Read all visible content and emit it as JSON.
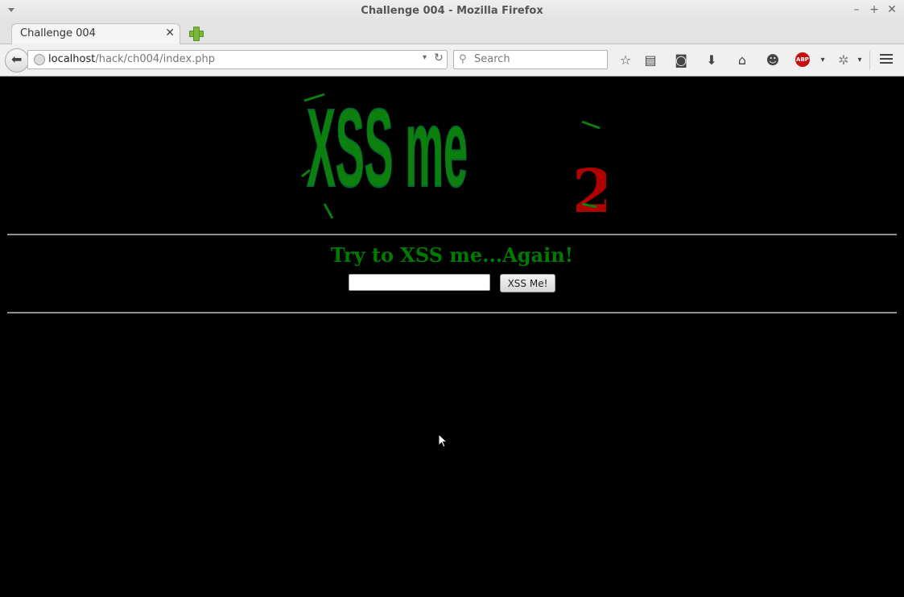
{
  "window": {
    "title": "Challenge 004 - Mozilla Firefox",
    "minimize_glyph": "–",
    "maximize_glyph": "+",
    "close_glyph": "✕"
  },
  "tabs": [
    {
      "label": "Challenge 004",
      "close_glyph": "✕"
    }
  ],
  "navbar": {
    "back_glyph": "⬅",
    "url_host": "localhost",
    "url_path": "/hack/ch004/index.php",
    "url_dropdown_glyph": "▾",
    "reload_glyph": "↻",
    "search_placeholder": "Search",
    "search_glyph": "⚲",
    "icons": [
      "bookmark-star-icon",
      "reading-list-icon",
      "pocket-icon",
      "download-icon",
      "home-icon",
      "chat-icon",
      "adblock-icon",
      "extension-icon",
      "menu-icon"
    ],
    "star_glyph": "☆",
    "list_glyph": "▤",
    "pocket_glyph": "◙",
    "download_glyph": "⬇",
    "home_glyph": "⌂",
    "chat_glyph": "☻",
    "abp_text": "ABP",
    "ext_glyph": "✲",
    "dropdown_glyph": "▾"
  },
  "page": {
    "logo_text": "XSS me",
    "logo_sub": "2",
    "heading": "Try to XSS me...Again!",
    "input_value": "",
    "button_label": "XSS Me!",
    "colors": {
      "background": "#000000",
      "heading": "#007a00",
      "logo_green": "#0d7f0d",
      "logo_red": "#b00000"
    }
  }
}
